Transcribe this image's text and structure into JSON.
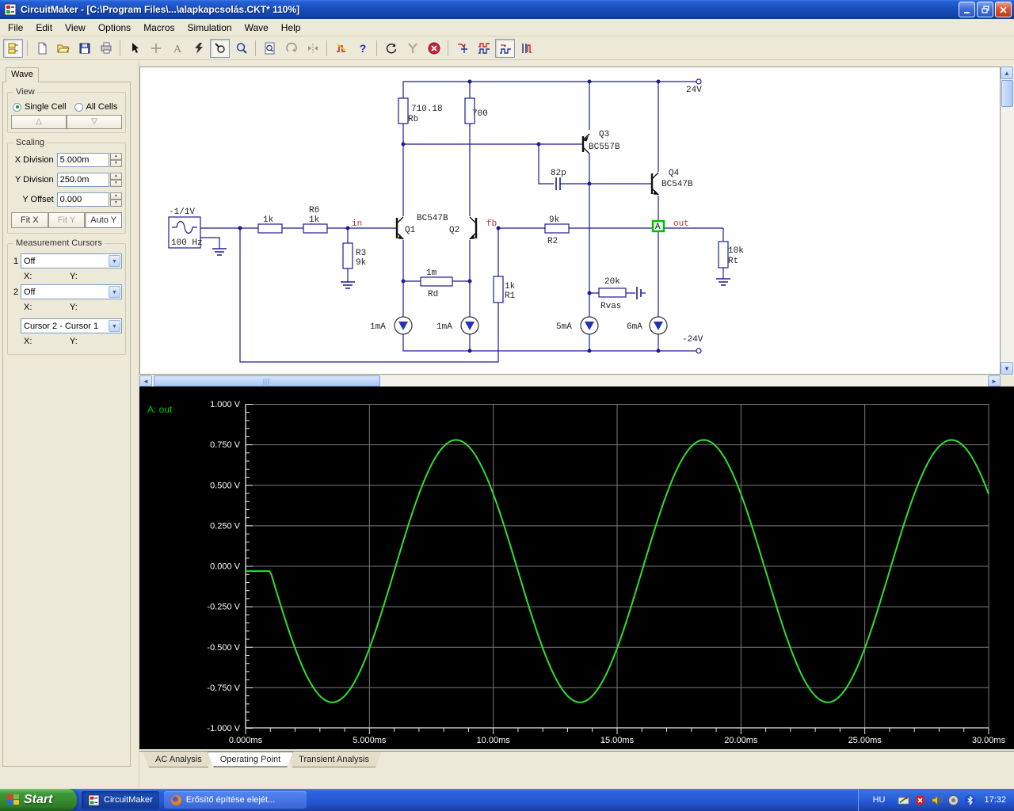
{
  "window": {
    "title": "CircuitMaker - [C:\\Program Files\\...\\alapkapcsolás.CKT* 110%]"
  },
  "menu": {
    "items": [
      "File",
      "Edit",
      "View",
      "Options",
      "Macros",
      "Simulation",
      "Wave",
      "Help"
    ]
  },
  "toolbar": {
    "icons": [
      {
        "name": "parts-browser",
        "pressed": true
      },
      {
        "name": "new-document"
      },
      {
        "name": "open-file"
      },
      {
        "name": "save-file"
      },
      {
        "name": "print"
      },
      {
        "name": "arrow-tool"
      },
      {
        "name": "wire-tool",
        "disabled": true
      },
      {
        "name": "text-tool",
        "disabled": true
      },
      {
        "name": "delete-tool"
      },
      {
        "name": "probe-tool",
        "pressed": true
      },
      {
        "name": "zoom-tool"
      },
      {
        "name": "zoom-page"
      },
      {
        "name": "rotate",
        "disabled": true
      },
      {
        "name": "mirror",
        "disabled": true
      },
      {
        "name": "digital-analog-mode"
      },
      {
        "name": "help"
      },
      {
        "name": "reset"
      },
      {
        "name": "step",
        "disabled": true
      },
      {
        "name": "stop"
      },
      {
        "name": "waveform-transient"
      },
      {
        "name": "waveform-digital"
      },
      {
        "name": "waveform-scope",
        "pressed": true
      },
      {
        "name": "waveform-signal"
      }
    ]
  },
  "left_panel": {
    "tab_label": "Wave",
    "view": {
      "legend": "View",
      "single_cell": "Single Cell",
      "all_cells": "All Cells",
      "up": "△",
      "down": "▽"
    },
    "scaling": {
      "legend": "Scaling",
      "x_label": "X Division",
      "x_value": "5.000m",
      "y_label": "Y Division",
      "y_value": "250.0m",
      "off_label": "Y Offset",
      "off_value": "0.000",
      "fit_x": "Fit X",
      "fit_y": "Fit Y",
      "auto_y": "Auto Y"
    },
    "cursors": {
      "legend": "Measurement Cursors",
      "c1_index": "1",
      "c1_value": "Off",
      "c2_index": "2",
      "c2_value": "Off",
      "diff_value": "Cursor 2 - Cursor 1",
      "x_label": "X:",
      "y_label": "Y:"
    }
  },
  "schematic": {
    "supply_pos": "24V",
    "supply_neg": "-24V",
    "rb": {
      "value": "710.18",
      "name": "Rb"
    },
    "r700": {
      "value": "700"
    },
    "q3": {
      "name": "Q3",
      "type": "BC557B"
    },
    "c82": {
      "value": "82p"
    },
    "q4": {
      "name": "Q4",
      "type": "BC547B"
    },
    "source": {
      "amplitude": "-1/1V",
      "frequency": "100 Hz"
    },
    "rin": {
      "value": "1k"
    },
    "r6": {
      "name": "R6",
      "value": "1k"
    },
    "node_in": "in",
    "q1": {
      "name": "Q1"
    },
    "q12_type": "BC547B",
    "q2": {
      "name": "Q2"
    },
    "node_fb": "fb",
    "r2": {
      "value": "9k",
      "name": "R2"
    },
    "r3": {
      "name": "R3",
      "value": "9k"
    },
    "rd": {
      "value": "1m",
      "name": "Rd"
    },
    "r1": {
      "value": "1k",
      "name": "R1"
    },
    "rvas": {
      "value": "20k",
      "name": "Rvas"
    },
    "i_sources": [
      {
        "value": "1mA"
      },
      {
        "value": "1mA"
      },
      {
        "value": "5mA"
      },
      {
        "value": "6mA"
      }
    ],
    "probe": "A",
    "node_out": "out",
    "rt": {
      "value": "10k",
      "name": "Rt"
    }
  },
  "chart_data": {
    "type": "line",
    "title": "A: out",
    "background": "#000000",
    "grid_color": "#7a7a7a",
    "axis_color": "#e8e8e8",
    "grid": true,
    "xlim_ms": [
      0,
      30
    ],
    "ylim_v": [
      -1,
      1
    ],
    "x_division_ms": 5,
    "y_division_v": 0.25,
    "x_ticks": [
      "0.000ms",
      "5.000ms",
      "10.00ms",
      "15.00ms",
      "20.00ms",
      "25.00ms",
      "30.00ms"
    ],
    "y_ticks": [
      "1.000 V",
      "0.750 V",
      "0.500 V",
      "0.250 V",
      "0.000 V",
      "-0.250 V",
      "-0.500 V",
      "-0.750 V",
      "-1.000 V"
    ],
    "series": [
      {
        "name": "A: out",
        "color": "#2ee02e",
        "waveform": {
          "shape": "sine",
          "polarity": "negative-first",
          "delay_ms": 1.0,
          "baseline_v": -0.03,
          "amplitude_v": 0.81,
          "period_ms": 10,
          "frequency_hz": 100
        },
        "sample_points": [
          {
            "t_ms": 0,
            "v": -0.03
          },
          {
            "t_ms": 1,
            "v": -0.03
          },
          {
            "t_ms": 3.5,
            "v": -0.84
          },
          {
            "t_ms": 6,
            "v": -0.03
          },
          {
            "t_ms": 8.5,
            "v": 0.78
          },
          {
            "t_ms": 11,
            "v": -0.03
          },
          {
            "t_ms": 13.5,
            "v": -0.84
          },
          {
            "t_ms": 16,
            "v": -0.03
          },
          {
            "t_ms": 18.5,
            "v": 0.78
          },
          {
            "t_ms": 21,
            "v": -0.03
          },
          {
            "t_ms": 23.5,
            "v": -0.84
          },
          {
            "t_ms": 26,
            "v": -0.03
          },
          {
            "t_ms": 28.5,
            "v": 0.78
          },
          {
            "t_ms": 30,
            "v": 0.45
          }
        ]
      }
    ]
  },
  "tabs": [
    {
      "label": "AC Analysis"
    },
    {
      "label": "Operating Point",
      "active": true
    },
    {
      "label": "Transient Analysis"
    }
  ],
  "taskbar": {
    "start_label": "Start",
    "tasks": [
      {
        "label": "CircuitMaker",
        "active": true
      },
      {
        "label": "Erősítő építése elejét..."
      }
    ],
    "tray": {
      "lang": "HU",
      "time": "17:32",
      "icons": [
        "pen-tablet",
        "security-alert",
        "volume",
        "wireless-mouse",
        "bluetooth"
      ]
    }
  }
}
